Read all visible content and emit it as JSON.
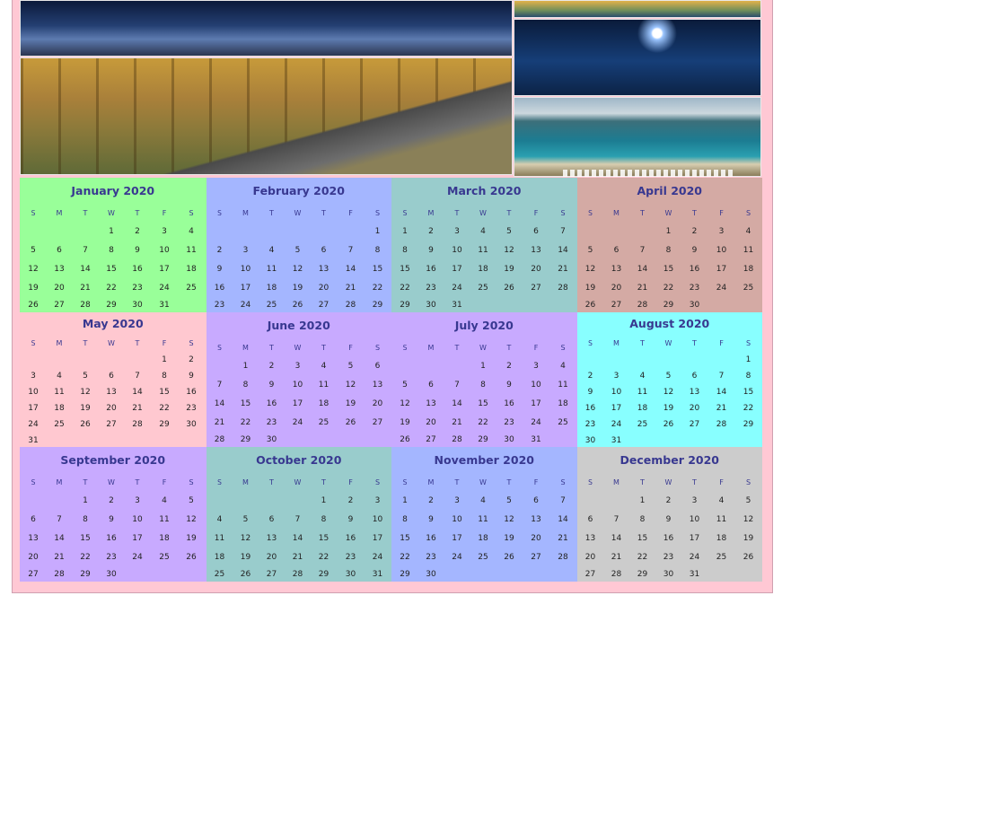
{
  "weekdays": [
    "S",
    "M",
    "T",
    "W",
    "T",
    "F",
    "S"
  ],
  "photos": [
    "night-cottage",
    "autumn-road",
    "sunset-coast",
    "moonlit-bay",
    "tropical-beach"
  ],
  "months": [
    {
      "name": "January 2020",
      "color": "#99ff99",
      "start": 3,
      "days": 31,
      "rows": 5
    },
    {
      "name": "February 2020",
      "color": "#a4b6ff",
      "start": 6,
      "days": 29,
      "rows": 5
    },
    {
      "name": "March 2020",
      "color": "#99cccc",
      "start": 0,
      "days": 31,
      "rows": 5
    },
    {
      "name": "April 2020",
      "color": "#d4aaa4",
      "start": 3,
      "days": 30,
      "rows": 5
    },
    {
      "name": "May 2020",
      "color": "#ffc8d0",
      "start": 5,
      "days": 31,
      "rows": 6
    },
    {
      "name": "June 2020",
      "color": "#c8aaff",
      "start": 1,
      "days": 30,
      "rows": 5
    },
    {
      "name": "July 2020",
      "color": "#c8aaff",
      "start": 3,
      "days": 31,
      "rows": 5
    },
    {
      "name": "August 2020",
      "color": "#88ffff",
      "start": 6,
      "days": 31,
      "rows": 6
    },
    {
      "name": "September 2020",
      "color": "#c8aaff",
      "start": 2,
      "days": 30,
      "rows": 5
    },
    {
      "name": "October 2020",
      "color": "#99cccc",
      "start": 4,
      "days": 31,
      "rows": 5
    },
    {
      "name": "November 2020",
      "color": "#a4b6ff",
      "start": 0,
      "days": 30,
      "rows": 5
    },
    {
      "name": "December 2020",
      "color": "#cccccc",
      "start": 2,
      "days": 31,
      "rows": 5
    }
  ]
}
